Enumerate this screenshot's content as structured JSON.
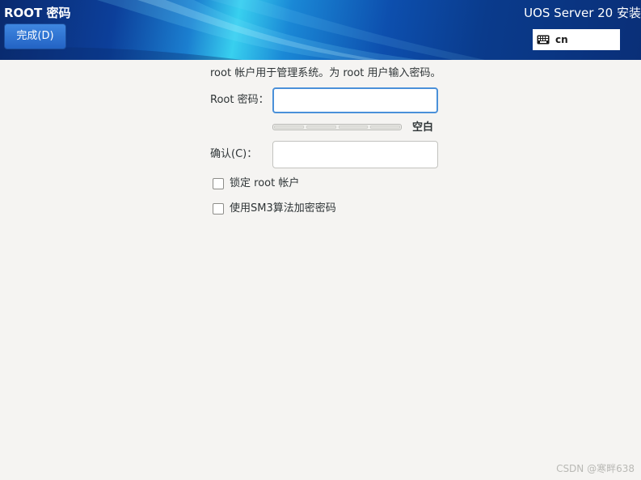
{
  "header": {
    "screen_title": "ROOT 密码",
    "done_button_label": "完成(D)",
    "product_title": "UOS Server 20 安装",
    "keyboard_layout": {
      "icon": "keyboard-icon",
      "code": "cn"
    }
  },
  "form": {
    "description": "root 帐户用于管理系统。为 root 用户输入密码。",
    "password": {
      "label": "Root 密码：",
      "value": ""
    },
    "strength": {
      "text": "空白",
      "level": 0
    },
    "confirm": {
      "label": "确认(C)：",
      "value": ""
    },
    "options": [
      {
        "label": "锁定 root 帐户",
        "checked": false
      },
      {
        "label": "使用SM3算法加密密码",
        "checked": false
      }
    ]
  },
  "watermark": "CSDN @寒畔638",
  "colors": {
    "accent": "#4a90d9",
    "done_button": "#2f74d0",
    "background": "#f5f4f2"
  }
}
